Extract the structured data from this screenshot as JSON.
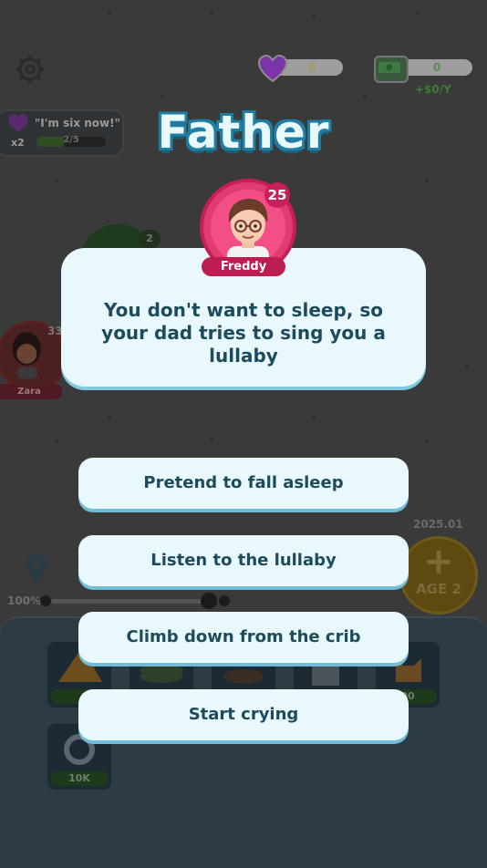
{
  "header": {
    "hearts_value": "0",
    "money_value": "0",
    "money_rate": "+$0/Y"
  },
  "quest": {
    "text": "\"I'm six now!\"",
    "multiplier": "x2",
    "progress_text": "2/5",
    "progress_fraction": 0.4
  },
  "background_characters": {
    "left_name": "Zara",
    "left_age": "33",
    "green_count": "2"
  },
  "age_panel": {
    "year": "2025.01",
    "age_label": "AGE 2",
    "plus_symbol": "+"
  },
  "zoom": {
    "percent": "100%"
  },
  "shop_tiles": [
    {
      "price": ""
    },
    {
      "price": ""
    },
    {
      "price": ""
    },
    {
      "price": ""
    },
    {
      "price": "00"
    },
    {
      "price": "10K"
    }
  ],
  "event": {
    "title": "Father",
    "character_name": "Freddy",
    "character_age": "25",
    "message": "You don't want to sleep, so your dad tries to sing you a lullaby"
  },
  "choices": [
    {
      "label": "Pretend to fall asleep"
    },
    {
      "label": "Listen to the lullaby"
    },
    {
      "label": "Climb down from the crib"
    },
    {
      "label": "Start crying"
    }
  ],
  "colors": {
    "title_outline": "#1f7ea1",
    "card_bg": "#e9f8fd",
    "choice_text": "#1c4b5c",
    "avatar_pink": "#e23b72"
  }
}
